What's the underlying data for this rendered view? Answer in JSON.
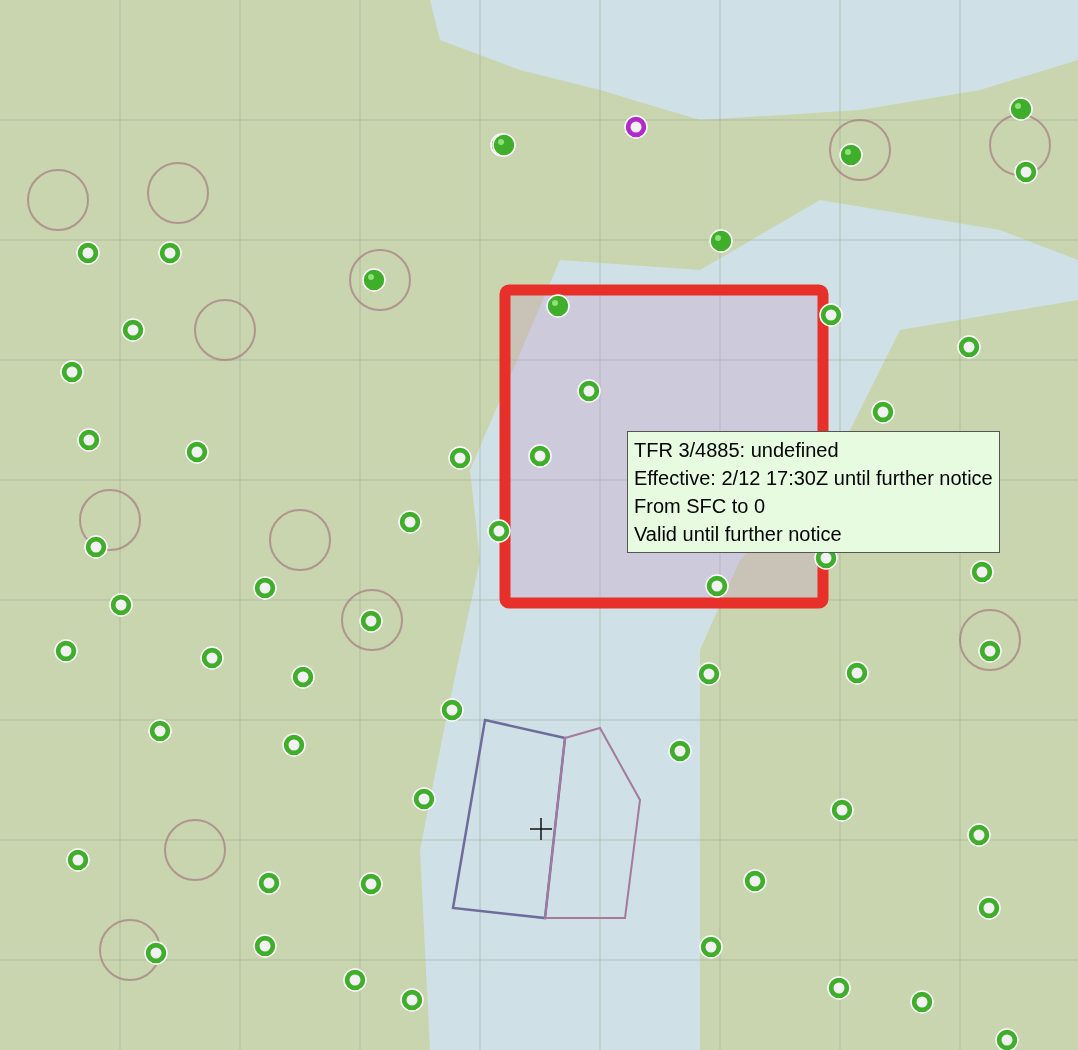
{
  "tfr_tooltip": {
    "lines": [
      "TFR 3/4885: undefined",
      "Effective: 2/12 17:30Z until further notice",
      "From SFC to 0",
      "Valid until further notice"
    ]
  },
  "tfr_area": {
    "selected": true
  },
  "markers": [
    {
      "kind": "dot",
      "color": "#3fae2a"
    },
    {
      "kind": "dot",
      "color": "#3fae2a"
    },
    {
      "kind": "dot",
      "color": "#3fae2a"
    },
    {
      "kind": "dot",
      "color": "#3fae2a"
    },
    {
      "kind": "dot",
      "color": "#3fae2a"
    },
    {
      "kind": "dot",
      "color": "#3fae2a"
    },
    {
      "kind": "dot",
      "color": "#3fae2a"
    },
    {
      "kind": "dot",
      "color": "#3fae2a"
    },
    {
      "kind": "dot",
      "color": "#3fae2a"
    },
    {
      "kind": "dot",
      "color": "#3fae2a"
    },
    {
      "kind": "dot",
      "color": "#3fae2a"
    },
    {
      "kind": "dot",
      "color": "#3fae2a"
    },
    {
      "kind": "dot",
      "color": "#3fae2a"
    },
    {
      "kind": "dot",
      "color": "#3fae2a"
    },
    {
      "kind": "dot",
      "color": "#3fae2a"
    },
    {
      "kind": "dot",
      "color": "#3fae2a"
    },
    {
      "kind": "dot",
      "color": "#3fae2a"
    },
    {
      "kind": "dot",
      "color": "#3fae2a"
    },
    {
      "kind": "dot",
      "color": "#3fae2a"
    },
    {
      "kind": "dot",
      "color": "#3fae2a"
    },
    {
      "kind": "dot",
      "color": "#3fae2a"
    },
    {
      "kind": "dot",
      "color": "#3fae2a"
    },
    {
      "kind": "dot",
      "color": "#3fae2a"
    },
    {
      "kind": "dot",
      "color": "#3fae2a"
    },
    {
      "kind": "dot",
      "color": "#3fae2a"
    },
    {
      "kind": "dot",
      "color": "#3fae2a"
    },
    {
      "kind": "dot",
      "color": "#3fae2a"
    },
    {
      "kind": "dot",
      "color": "#3fae2a"
    },
    {
      "kind": "dot",
      "color": "#3fae2a"
    },
    {
      "kind": "dot",
      "color": "#3fae2a"
    },
    {
      "kind": "dot",
      "color": "#3fae2a"
    },
    {
      "kind": "dot",
      "color": "#3fae2a"
    },
    {
      "kind": "dot",
      "color": "#3fae2a"
    },
    {
      "kind": "dot",
      "color": "#3fae2a"
    },
    {
      "kind": "dot",
      "color": "#3fae2a"
    },
    {
      "kind": "dot",
      "color": "#3fae2a"
    },
    {
      "kind": "dot",
      "color": "#3fae2a"
    },
    {
      "kind": "dot",
      "color": "#3fae2a"
    },
    {
      "kind": "dot",
      "color": "#3fae2a"
    },
    {
      "kind": "dot",
      "color": "#3fae2a"
    },
    {
      "kind": "dot",
      "color": "#3fae2a"
    },
    {
      "kind": "dot",
      "color": "#3fae2a"
    },
    {
      "kind": "dot",
      "color": "#3fae2a"
    },
    {
      "kind": "dot",
      "color": "#3fae2a"
    },
    {
      "kind": "dot",
      "color": "#3fae2a"
    },
    {
      "kind": "dot",
      "color": "#3fae2a"
    },
    {
      "kind": "dot",
      "color": "#3fae2a"
    },
    {
      "kind": "dot",
      "color": "#3fae2a"
    },
    {
      "kind": "dot",
      "color": "#3fae2a"
    },
    {
      "kind": "solid",
      "color": "#3fae2a"
    },
    {
      "kind": "solid",
      "color": "#3fae2a"
    },
    {
      "kind": "solid",
      "color": "#3fae2a"
    },
    {
      "kind": "solid",
      "color": "#3fae2a"
    },
    {
      "kind": "solid",
      "color": "#3fae2a"
    },
    {
      "kind": "solid",
      "color": "#3fae2a"
    },
    {
      "kind": "dot",
      "color": "#b02bc8"
    }
  ]
}
